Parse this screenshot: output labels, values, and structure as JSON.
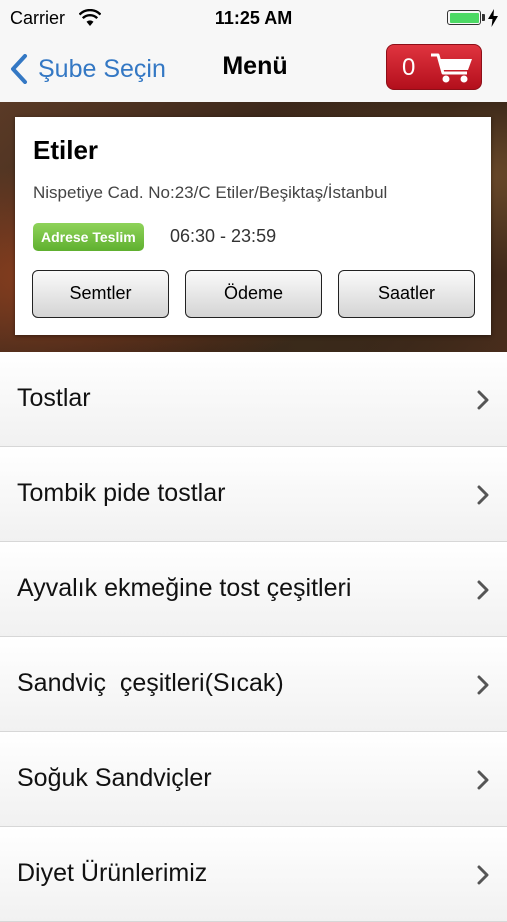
{
  "status_bar": {
    "carrier": "Carrier",
    "time": "11:25 AM",
    "battery_color": "#4cd964"
  },
  "nav": {
    "back_label": "Şube Seçin",
    "title": "Menü",
    "cart_count": "0",
    "back_color": "#3478c4",
    "cart_color": "#c8202b"
  },
  "branch": {
    "name": "Etiler",
    "address": "Nispetiye Cad. No:23/C Etiler/Beşiktaş/İstanbul",
    "badge": "Adrese Teslim",
    "hours": "06:30 - 23:59",
    "buttons": [
      "Semtler",
      "Ödeme",
      "Saatler"
    ]
  },
  "menu": {
    "items": [
      {
        "label": "Tostlar"
      },
      {
        "label": "Tombik pide tostlar"
      },
      {
        "label": "Ayvalık ekmeğine tost çeşitleri"
      },
      {
        "label": "Sandviç  çeşitleri(Sıcak)"
      },
      {
        "label": "Soğuk Sandviçler"
      },
      {
        "label": "Diyet Ürünlerimiz"
      }
    ]
  }
}
